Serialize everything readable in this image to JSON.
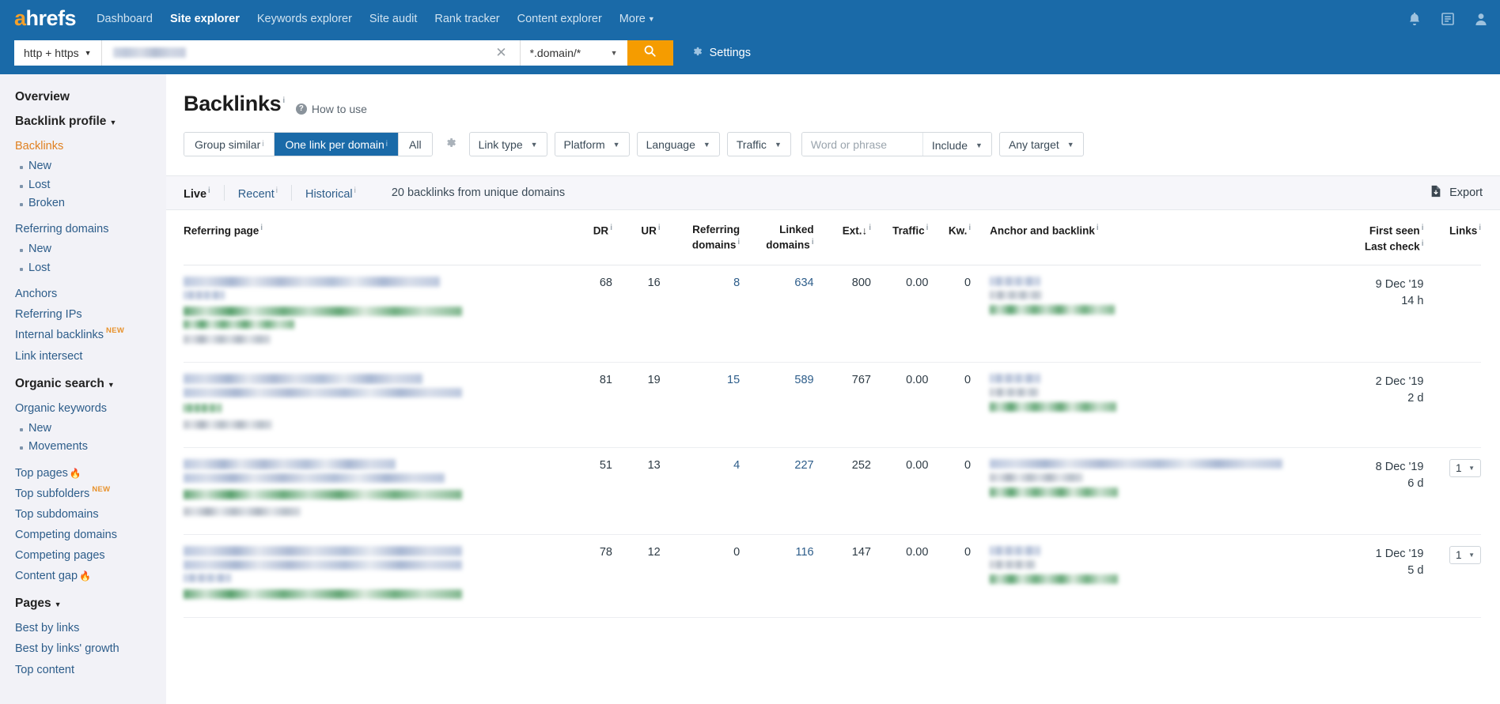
{
  "topnav": {
    "logo_a": "a",
    "logo_rest": "hrefs",
    "items": [
      {
        "label": "Dashboard",
        "active": false,
        "caret": false
      },
      {
        "label": "Site explorer",
        "active": true,
        "caret": false
      },
      {
        "label": "Keywords explorer",
        "active": false,
        "caret": false
      },
      {
        "label": "Site audit",
        "active": false,
        "caret": false
      },
      {
        "label": "Rank tracker",
        "active": false,
        "caret": false
      },
      {
        "label": "Content explorer",
        "active": false,
        "caret": false
      },
      {
        "label": "More",
        "active": false,
        "caret": true
      }
    ],
    "right_icons": [
      "bell-icon",
      "report-icon",
      "account-icon"
    ]
  },
  "searchbar": {
    "protocol": "http + https",
    "target_value": "",
    "target_redacted": true,
    "clear_glyph": "✕",
    "scope": "*.domain/*",
    "search_icon": "search-icon",
    "settings_label": "Settings",
    "settings_icon": "gear-icon"
  },
  "sidebar": {
    "overview": "Overview",
    "groups": [
      {
        "heading": "Backlink profile",
        "caret": true,
        "items": [
          {
            "label": "Backlinks",
            "type": "link",
            "active": true
          },
          {
            "label": "New",
            "type": "sub"
          },
          {
            "label": "Lost",
            "type": "sub"
          },
          {
            "label": "Broken",
            "type": "sub"
          },
          {
            "label": "Referring domains",
            "type": "link",
            "gap": true
          },
          {
            "label": "New",
            "type": "sub"
          },
          {
            "label": "Lost",
            "type": "sub"
          },
          {
            "label": "Anchors",
            "type": "link",
            "gap": true
          },
          {
            "label": "Referring IPs",
            "type": "link"
          },
          {
            "label": "Internal backlinks",
            "type": "link",
            "badge": "NEW"
          },
          {
            "label": "Link intersect",
            "type": "link"
          }
        ]
      },
      {
        "heading": "Organic search",
        "caret": true,
        "items": [
          {
            "label": "Organic keywords",
            "type": "link"
          },
          {
            "label": "New",
            "type": "sub"
          },
          {
            "label": "Movements",
            "type": "sub"
          },
          {
            "label": "Top pages",
            "type": "link",
            "flame": true,
            "gap": true
          },
          {
            "label": "Top subfolders",
            "type": "link",
            "badge": "NEW"
          },
          {
            "label": "Top subdomains",
            "type": "link"
          },
          {
            "label": "Competing domains",
            "type": "link"
          },
          {
            "label": "Competing pages",
            "type": "link"
          },
          {
            "label": "Content gap",
            "type": "link",
            "flame": true
          }
        ]
      },
      {
        "heading": "Pages",
        "caret": true,
        "items": [
          {
            "label": "Best by links",
            "type": "link"
          },
          {
            "label": "Best by links' growth",
            "type": "link"
          },
          {
            "label": "Top content",
            "type": "link"
          }
        ]
      }
    ]
  },
  "main": {
    "title": "Backlinks",
    "how_to_use": "How to use",
    "info_mark": "i",
    "toolbar": {
      "segments": [
        {
          "label": "Group similar",
          "active": false,
          "info": true
        },
        {
          "label": "One link per domain",
          "active": true,
          "info": true
        },
        {
          "label": "All",
          "active": false,
          "info": false
        }
      ],
      "gear_icon": "gear-icon",
      "dropdowns": [
        "Link type",
        "Platform",
        "Language",
        "Traffic"
      ],
      "word_placeholder": "Word or phrase",
      "word_value": "",
      "include": "Include",
      "target": "Any target"
    },
    "tabs": [
      {
        "label": "Live",
        "active": true,
        "info": true
      },
      {
        "label": "Recent",
        "active": false,
        "info": true
      },
      {
        "label": "Historical",
        "active": false,
        "info": true
      }
    ],
    "count_text": "20 backlinks from unique domains",
    "export_label": "Export",
    "export_icon": "download-file-icon"
  },
  "table": {
    "columns": [
      {
        "label": "Referring page",
        "align": "left",
        "info": true
      },
      {
        "label": "DR",
        "align": "right",
        "info": true
      },
      {
        "label": "UR",
        "align": "right",
        "info": true
      },
      {
        "label": "Referring domains",
        "align": "right",
        "info": true
      },
      {
        "label": "Linked domains",
        "align": "right",
        "info": true
      },
      {
        "label": "Ext.",
        "align": "right",
        "info": true,
        "sort": "desc"
      },
      {
        "label": "Traffic",
        "align": "right",
        "info": true
      },
      {
        "label": "Kw.",
        "align": "right",
        "info": true
      },
      {
        "label": "Anchor and backlink",
        "align": "left",
        "info": true
      },
      {
        "label": "First seen",
        "label2": "Last check",
        "align": "right",
        "info": true
      },
      {
        "label": "Links",
        "align": "right",
        "info": true
      }
    ],
    "rows": [
      {
        "referring_page_redacted": true,
        "dr": "68",
        "ur": "16",
        "referring_domains": "8",
        "linked_domains": "634",
        "ext": "800",
        "traffic": "0.00",
        "kw": "0",
        "anchor_redacted": true,
        "first_seen": "9 Dec '19",
        "last_check": "14 h",
        "links": null
      },
      {
        "referring_page_redacted": true,
        "dr": "81",
        "ur": "19",
        "referring_domains": "15",
        "linked_domains": "589",
        "ext": "767",
        "traffic": "0.00",
        "kw": "0",
        "anchor_redacted": true,
        "first_seen": "2 Dec '19",
        "last_check": "2 d",
        "links": null
      },
      {
        "referring_page_redacted": true,
        "dr": "51",
        "ur": "13",
        "referring_domains": "4",
        "linked_domains": "227",
        "ext": "252",
        "traffic": "0.00",
        "kw": "0",
        "anchor_redacted": true,
        "first_seen": "8 Dec '19",
        "last_check": "6 d",
        "links": "1"
      },
      {
        "referring_page_redacted": true,
        "dr": "78",
        "ur": "12",
        "referring_domains": "0",
        "linked_domains": "116",
        "ext": "147",
        "traffic": "0.00",
        "kw": "0",
        "anchor_redacted": true,
        "first_seen": "1 Dec '19",
        "last_check": "5 d",
        "links": "1"
      }
    ]
  }
}
